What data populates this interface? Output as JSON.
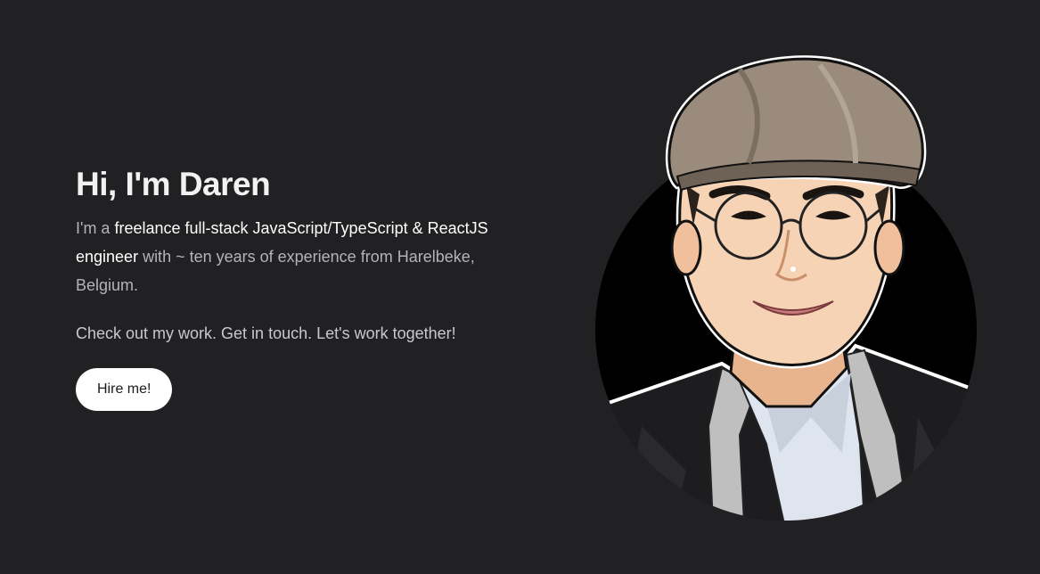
{
  "hero": {
    "headline": "Hi, I'm Daren",
    "bio": {
      "prefix": "I'm a ",
      "highlight1": "freelance full-stack JavaScript/TypeScript & ReactJS engineer",
      "middle": " with ~ ten years of experience from Harelbeke, Belgium."
    },
    "cta_text": "Check out my work. Get in touch. Let's work together!",
    "hire_button_label": "Hire me!"
  },
  "avatar": {
    "icon": "cartoon-portrait-avatar",
    "background_color": "#000000",
    "cap_color": "#9a8b7c"
  },
  "colors": {
    "page_background": "#212123",
    "headline": "#f2f2f2",
    "body_text": "#b4b4b8",
    "button_background": "#ffffff"
  }
}
